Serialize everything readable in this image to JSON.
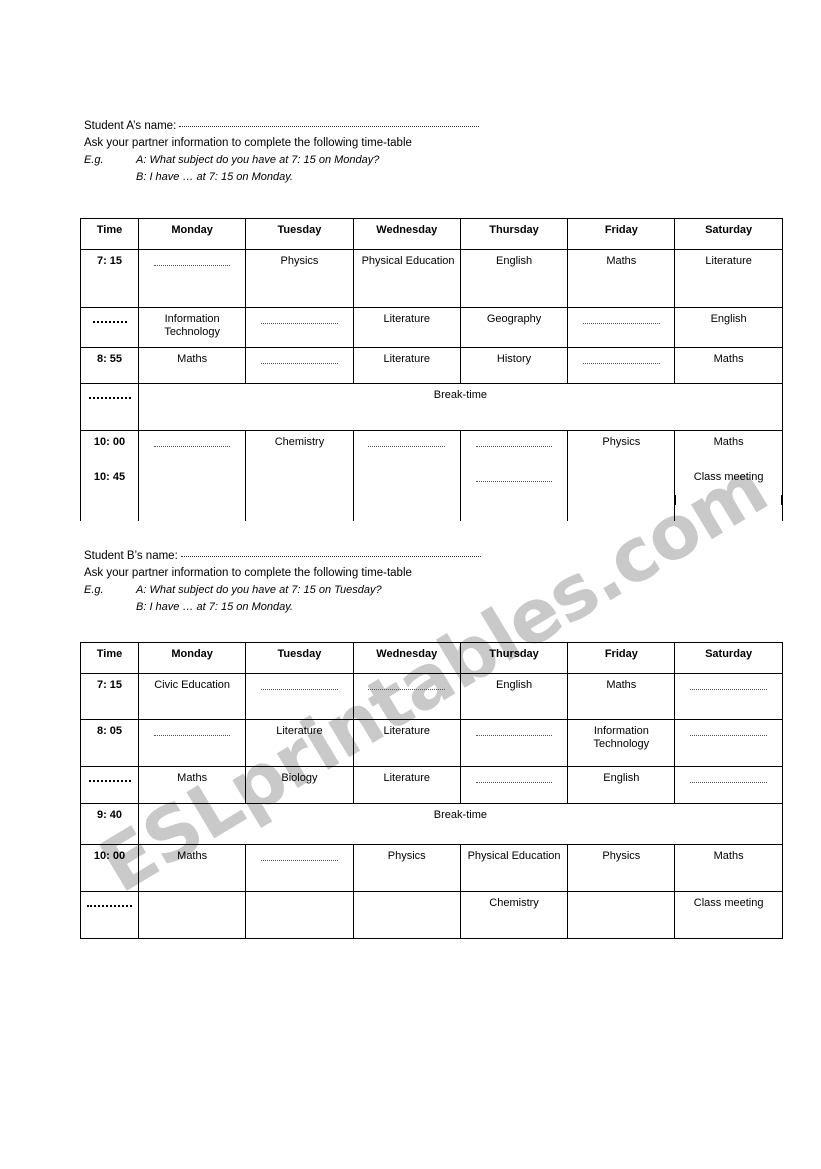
{
  "watermark": {
    "text": "ESLprintables.com"
  },
  "sections": [
    {
      "id": "student-a",
      "name_label": "Student A’s name:",
      "instruction": "Ask your partner information to complete the following time-table",
      "eg_label": "E.g.",
      "eg_a": "A: What subject do you have at 7: 15 on Monday?",
      "eg_b": "B: I have … at 7: 15 on Monday.",
      "table": {
        "headers": [
          "Time",
          "Monday",
          "Tuesday",
          "Wednesday",
          "Thursday",
          "Friday",
          "Saturday"
        ],
        "break_label": "Break-time",
        "rows": [
          {
            "time": "7: 15",
            "time_blank": false,
            "cells": [
              "",
              "Physics",
              "Physical Education",
              "English",
              "Maths",
              "Literature"
            ],
            "blanks": [
              true,
              false,
              false,
              false,
              false,
              false
            ]
          },
          {
            "time": "",
            "time_blank": true,
            "cells": [
              "Information Technology",
              "",
              "Literature",
              "Geography",
              "",
              "English"
            ],
            "blanks": [
              false,
              true,
              false,
              false,
              true,
              false
            ]
          },
          {
            "time": "8: 55",
            "time_blank": false,
            "cells": [
              "Maths",
              "",
              "Literature",
              "History",
              "",
              "Maths"
            ],
            "blanks": [
              false,
              true,
              false,
              false,
              true,
              false
            ]
          },
          {
            "time": "",
            "time_blank": true,
            "is_break": true
          },
          {
            "time": "10: 00",
            "time2": "10: 45",
            "time_blank": false,
            "cells": [
              "",
              "Chemistry",
              "",
              "",
              "Physics",
              "Maths"
            ],
            "blanks": [
              true,
              false,
              true,
              true,
              false,
              false
            ],
            "cells2": [
              "",
              "",
              "",
              "",
              "",
              "Class meeting"
            ],
            "blanks2": [
              false,
              false,
              false,
              true,
              false,
              false
            ]
          }
        ]
      }
    },
    {
      "id": "student-b",
      "name_label": "Student B’s name:",
      "instruction": "Ask your partner information to complete the following time-table",
      "eg_label": "E.g.",
      "eg_a": "A: What subject do you have at 7: 15 on Tuesday?",
      "eg_b": "B: I have … at 7: 15 on Monday.",
      "table": {
        "headers": [
          "Time",
          "Monday",
          "Tuesday",
          "Wednesday",
          "Thursday",
          "Friday",
          "Saturday"
        ],
        "break_label": "Break-time",
        "rows": [
          {
            "time": "7: 15",
            "time_blank": false,
            "cells": [
              "Civic Education",
              "",
              "",
              "English",
              "Maths",
              ""
            ],
            "blanks": [
              false,
              true,
              true,
              false,
              false,
              true
            ]
          },
          {
            "time": "8: 05",
            "time_blank": false,
            "cells": [
              "",
              "Literature",
              "Literature",
              "",
              "Information Technology",
              ""
            ],
            "blanks": [
              true,
              false,
              false,
              true,
              false,
              true
            ]
          },
          {
            "time": "",
            "time_blank": true,
            "cells": [
              "Maths",
              "Biology",
              "Literature",
              "",
              "English",
              ""
            ],
            "blanks": [
              false,
              false,
              false,
              true,
              false,
              true
            ]
          },
          {
            "time": "9: 40",
            "time_blank": false,
            "is_break": true
          },
          {
            "time": "10: 00",
            "time_blank": false,
            "cells": [
              "Maths",
              "",
              "Physics",
              "Physical Education",
              "Physics",
              "Maths"
            ],
            "blanks": [
              false,
              true,
              false,
              false,
              false,
              false
            ]
          },
          {
            "time": "",
            "time_blank": true,
            "cells": [
              "",
              "",
              "",
              "Chemistry",
              "",
              "Class meeting"
            ],
            "blanks": [
              false,
              false,
              false,
              false,
              false,
              false
            ]
          }
        ]
      }
    }
  ]
}
